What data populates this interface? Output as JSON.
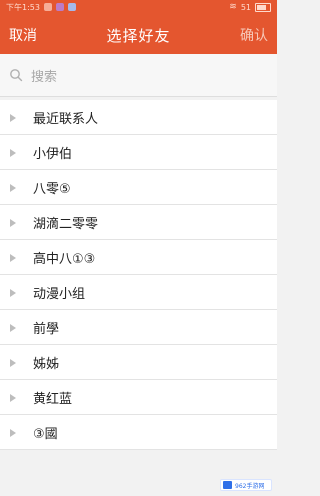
{
  "statusbar": {
    "left_text": "下午1:53",
    "right_text": "51"
  },
  "appbar": {
    "cancel_label": "取消",
    "title": "选择好友",
    "confirm_label": "确认"
  },
  "search": {
    "placeholder": "搜索"
  },
  "list": {
    "items": [
      {
        "label": "最近联系人"
      },
      {
        "label": "小伊伯"
      },
      {
        "label": "八零⑤"
      },
      {
        "label": "湖滴二零零"
      },
      {
        "label": "高中八①③"
      },
      {
        "label": "动漫小组"
      },
      {
        "label": "前學"
      },
      {
        "label": "姊姊"
      },
      {
        "label": "黄红蓝"
      },
      {
        "label": "③國"
      }
    ]
  },
  "watermark": {
    "text": "962手游网"
  },
  "colors": {
    "accent": "#e4562f"
  }
}
